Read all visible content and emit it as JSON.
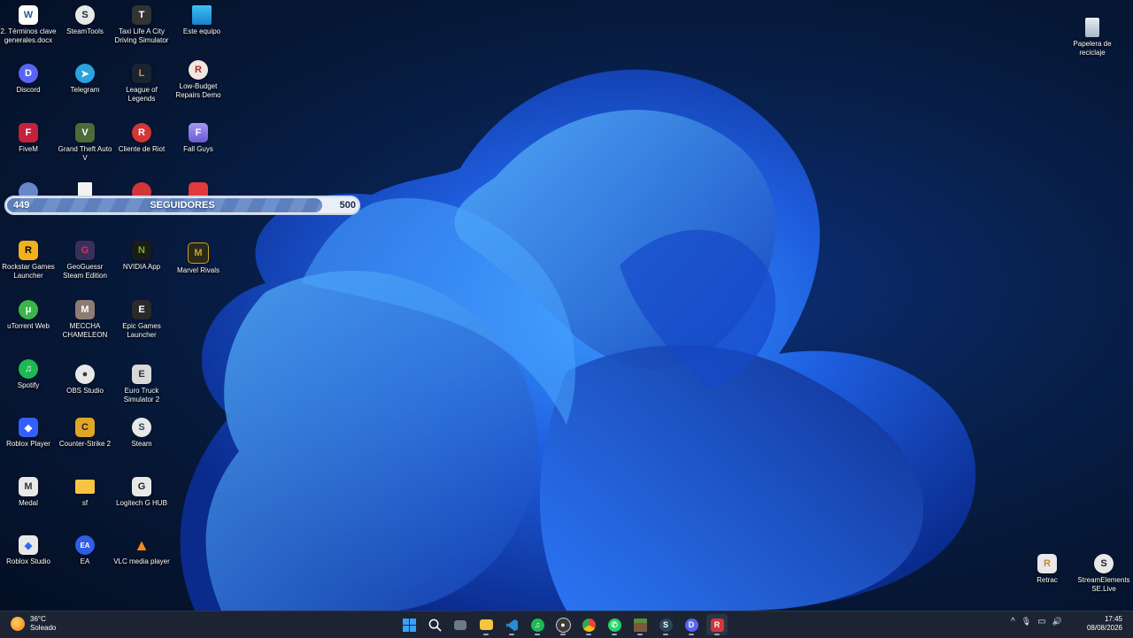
{
  "desktop": {
    "icons": [
      {
        "id": "doc",
        "label": "2. Términos clave generales.docx",
        "glyph": "W",
        "color": "#2b5797"
      },
      {
        "id": "steamtools",
        "label": "SteamTools",
        "glyph": "S",
        "color": "#1b2838"
      },
      {
        "id": "taxi",
        "label": "Taxi Life A City Driving Simulator",
        "glyph": "T",
        "color": "#333333"
      },
      {
        "id": "este-equipo",
        "label": "Este equipo",
        "glyph": "",
        "color": "#2aa3d6"
      },
      {
        "id": "discord",
        "label": "Discord",
        "glyph": "D",
        "color": "#5865f2"
      },
      {
        "id": "telegram",
        "label": "Telegram",
        "glyph": "➤",
        "color": "#2aa3df"
      },
      {
        "id": "lol",
        "label": "League of Legends",
        "glyph": "L",
        "color": "#c89b3c"
      },
      {
        "id": "lowbudget",
        "label": "Low-Budget Repairs Demo",
        "glyph": "R",
        "color": "#b5282a"
      },
      {
        "id": "fivem",
        "label": "FiveM",
        "glyph": "F",
        "color": "#e0345a"
      },
      {
        "id": "gta",
        "label": "Grand Theft Auto V",
        "glyph": "V",
        "color": "#4b6b3a"
      },
      {
        "id": "riot",
        "label": "Cliente de Riot",
        "glyph": "R",
        "color": "#d13639"
      },
      {
        "id": "fallguys",
        "label": "Fall Guys",
        "glyph": "F",
        "color": "#7f6fd6"
      },
      {
        "id": "hidden1",
        "label": "",
        "glyph": "",
        "color": "#6a86c9"
      },
      {
        "id": "hidden2",
        "label": "",
        "glyph": "",
        "color": "#f2f2f2"
      },
      {
        "id": "hidden3",
        "label": "",
        "glyph": "",
        "color": "#d13639"
      },
      {
        "id": "hidden4",
        "label": "",
        "glyph": "",
        "color": "#e03a3e"
      },
      {
        "id": "rockstar",
        "label": "Rockstar Games Launcher",
        "glyph": "R",
        "color": "#f2b01e"
      },
      {
        "id": "geoguessr",
        "label": "GeoGuessr Steam Edition",
        "glyph": "G",
        "color": "#d3324f"
      },
      {
        "id": "nvidia",
        "label": "NVIDIA App",
        "glyph": "N",
        "color": "#76b900"
      },
      {
        "id": "marvel",
        "label": "Marvel Rivals",
        "glyph": "M",
        "color": "#c9a227"
      },
      {
        "id": "utorrent",
        "label": "uTorrent Web",
        "glyph": "μ",
        "color": "#3bb54a"
      },
      {
        "id": "meccha",
        "label": "MECCHA CHAMELEON",
        "glyph": "M",
        "color": "#8d7c72"
      },
      {
        "id": "epic",
        "label": "Epic Games Launcher",
        "glyph": "E",
        "color": "#2a2a2a"
      },
      {
        "id": "spotify",
        "label": "Spotify",
        "glyph": "♫",
        "color": "#1db954"
      },
      {
        "id": "obs",
        "label": "OBS Studio",
        "glyph": "●",
        "color": "#3a3a3a"
      },
      {
        "id": "ets2",
        "label": "Euro Truck Simulator 2",
        "glyph": "E",
        "color": "#d9d9d9"
      },
      {
        "id": "roblox",
        "label": "Roblox Player",
        "glyph": "◆",
        "color": "#335fff"
      },
      {
        "id": "cs2",
        "label": "Counter-Strike 2",
        "glyph": "C",
        "color": "#e0a526"
      },
      {
        "id": "steam",
        "label": "Steam",
        "glyph": "S",
        "color": "#2a475e"
      },
      {
        "id": "medal",
        "label": "Medal",
        "glyph": "M",
        "color": "#e8e8e8"
      },
      {
        "id": "folder-sf",
        "label": "sf",
        "glyph": "",
        "color": "#f5c542"
      },
      {
        "id": "ghub",
        "label": "Logitech G HUB",
        "glyph": "G",
        "color": "#e8e8e8"
      },
      {
        "id": "robloxstudio",
        "label": "Roblox Studio",
        "glyph": "◆",
        "color": "#e8e8e8"
      },
      {
        "id": "ea",
        "label": "EA",
        "glyph": "EA",
        "color": "#2f5ee6"
      },
      {
        "id": "vlc",
        "label": "VLC media player",
        "glyph": "▲",
        "color": "#f08a1a"
      },
      {
        "id": "papelera",
        "label": "Papelera de reciclaje",
        "glyph": "",
        "color": "#cfd8e3"
      },
      {
        "id": "retrac",
        "label": "Retrac",
        "glyph": "R",
        "color": "#e8e8e8"
      },
      {
        "id": "streamelements",
        "label": "StreamElements SE.Live",
        "glyph": "S",
        "color": "#e8e8e8"
      }
    ]
  },
  "follower_bar": {
    "current": "449",
    "title": "SEGUIDORES",
    "goal": "500",
    "progress": 0.898
  },
  "taskbar": {
    "weather": {
      "temp": "36°C",
      "condition": "Soleado"
    },
    "apps": [
      {
        "name": "start",
        "glyph": "",
        "color": "#3aa0ff"
      },
      {
        "name": "search",
        "glyph": "",
        "color": "transparent"
      },
      {
        "name": "task-view",
        "glyph": "",
        "color": "#6d7889"
      },
      {
        "name": "file-explorer",
        "glyph": "",
        "color": "#f5c542"
      },
      {
        "name": "vscode",
        "glyph": "",
        "color": "#2b8bd6"
      },
      {
        "name": "spotify",
        "glyph": "♫",
        "color": "#1db954"
      },
      {
        "name": "obs",
        "glyph": "●",
        "color": "#3a3a3a"
      },
      {
        "name": "chrome",
        "glyph": "",
        "color": "#e8453c"
      },
      {
        "name": "whatsapp",
        "glyph": "✆",
        "color": "#25d366"
      },
      {
        "name": "minecraft",
        "glyph": "",
        "color": "#7a5a3a"
      },
      {
        "name": "steam",
        "glyph": "S",
        "color": "#2a475e"
      },
      {
        "name": "discord",
        "glyph": "D",
        "color": "#5865f2"
      },
      {
        "name": "riot",
        "glyph": "R",
        "color": "#d13639"
      }
    ],
    "tray": {
      "chevron": "^",
      "mic": "🎙",
      "network": "▭",
      "volume": "🔊"
    },
    "clock": {
      "time": "17:45",
      "date": "08/08/2026"
    }
  }
}
